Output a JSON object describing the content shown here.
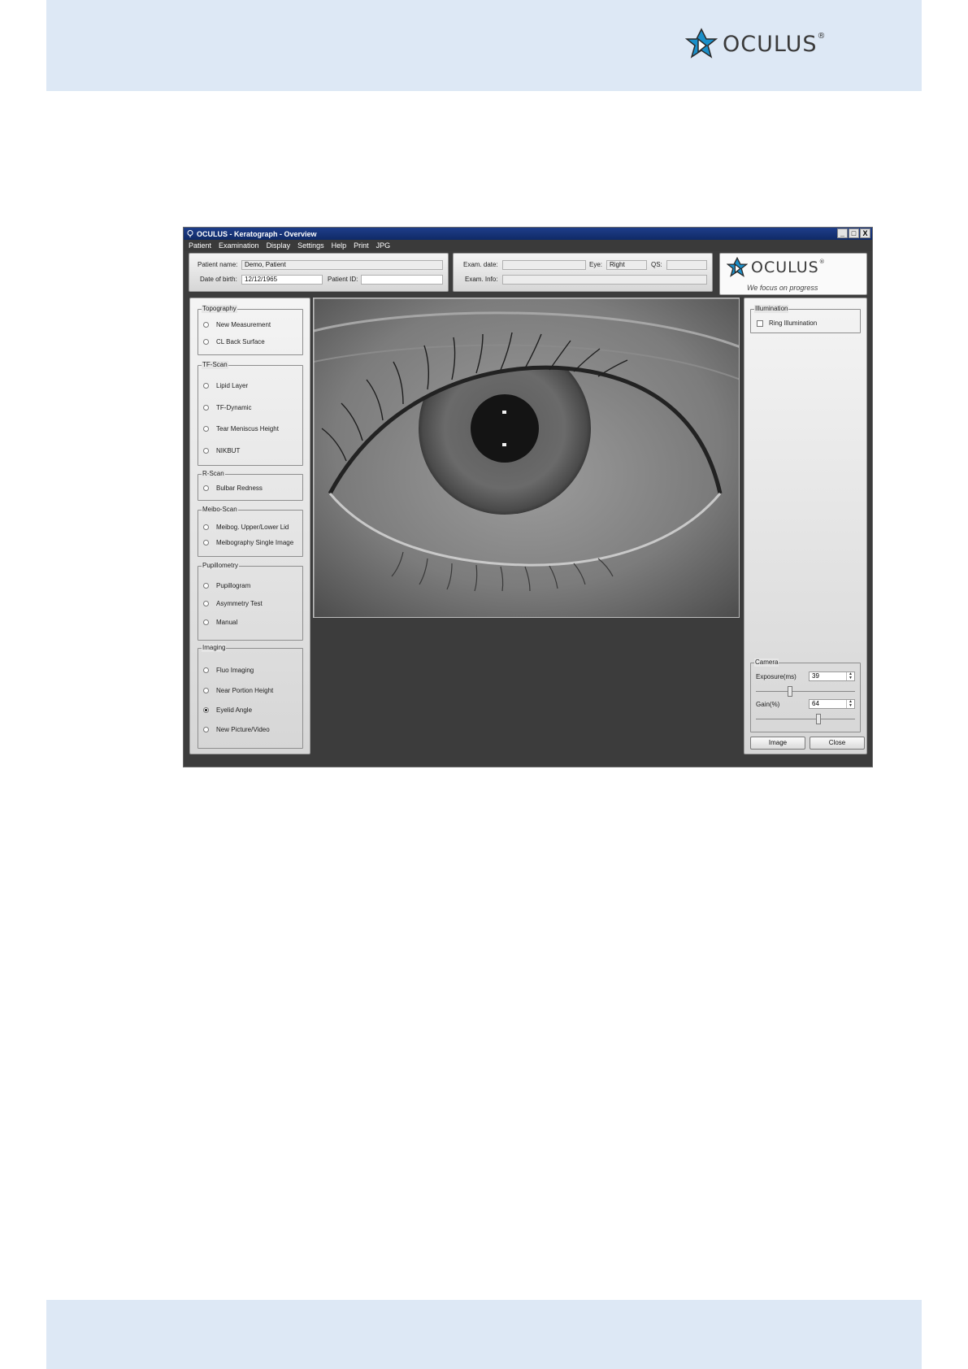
{
  "document": {
    "brand": "OCULUS",
    "brand_mark": "®"
  },
  "window": {
    "title": "OCULUS - Keratograph - Overview",
    "controls": [
      "_",
      "□",
      "X"
    ],
    "menu": [
      "Patient",
      "Examination",
      "Display",
      "Settings",
      "Help",
      "Print",
      "JPG"
    ]
  },
  "patient": {
    "name_label": "Patient name:",
    "name": "Demo, Patient",
    "dob_label": "Date of birth:",
    "dob": "12/12/1965",
    "id_label": "Patient ID:",
    "id": ""
  },
  "exam": {
    "date_label": "Exam. date:",
    "date": "",
    "eye_label": "Eye:",
    "eye": "Right",
    "qs_label": "QS:",
    "qs": "",
    "info_label": "Exam. Info:",
    "info": ""
  },
  "logo": {
    "text": "OCULUS",
    "mark": "®",
    "tagline": "We focus on progress"
  },
  "groups": [
    {
      "title": "Topography",
      "items": [
        {
          "label": "New Measurement",
          "selected": false
        },
        {
          "label": "CL Back Surface",
          "selected": false
        }
      ]
    },
    {
      "title": "TF-Scan",
      "items": [
        {
          "label": "Lipid Layer",
          "selected": false
        },
        {
          "label": "TF-Dynamic",
          "selected": false
        },
        {
          "label": "Tear Meniscus Height",
          "selected": false
        },
        {
          "label": "NIKBUT",
          "selected": false
        }
      ]
    },
    {
      "title": "R-Scan",
      "items": [
        {
          "label": "Bulbar Redness",
          "selected": false
        }
      ]
    },
    {
      "title": "Meibo-Scan",
      "items": [
        {
          "label": "Meibog. Upper/Lower Lid",
          "selected": false
        },
        {
          "label": "Meibography Single Image",
          "selected": false
        }
      ]
    },
    {
      "title": "Pupillometry",
      "items": [
        {
          "label": "Pupillogram",
          "selected": false
        },
        {
          "label": "Asymmetry Test",
          "selected": false
        },
        {
          "label": "Manual",
          "selected": false
        }
      ]
    },
    {
      "title": "Imaging",
      "items": [
        {
          "label": "Fluo Imaging",
          "selected": false
        },
        {
          "label": "Near Portion Height",
          "selected": false
        },
        {
          "label": "Eyelid Angle",
          "selected": true
        },
        {
          "label": "New Picture/Video",
          "selected": false
        }
      ]
    }
  ],
  "illumination": {
    "title": "Illumination",
    "ring_label": "Ring Illumination",
    "ring_checked": false
  },
  "camera": {
    "title": "Camera",
    "exposure_label": "Exposure(ms)",
    "exposure": "39",
    "exposure_level": 0.34,
    "gain_label": "Gain(%)",
    "gain": "64",
    "gain_level": 0.64
  },
  "buttons": {
    "image": "Image",
    "close": "Close"
  }
}
